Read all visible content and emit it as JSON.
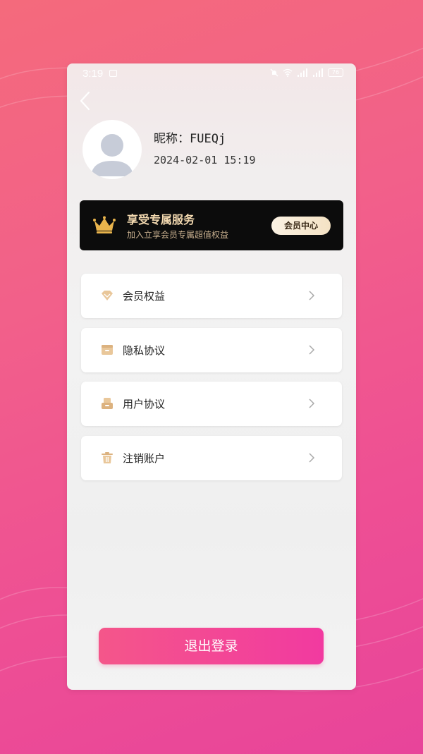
{
  "status_bar": {
    "time": "3:19",
    "battery": "76"
  },
  "profile": {
    "nickname_label": "昵称：",
    "nickname": "FUEQj",
    "datetime": "2024-02-01 15:19"
  },
  "vip_banner": {
    "title": "享受专属服务",
    "subtitle": "加入立享会员专属超值权益",
    "button_label": "会员中心"
  },
  "menu": [
    {
      "label": "会员权益",
      "icon": "diamond-icon"
    },
    {
      "label": "隐私协议",
      "icon": "document-box-icon"
    },
    {
      "label": "用户协议",
      "icon": "tray-icon"
    },
    {
      "label": "注销账户",
      "icon": "trash-icon"
    }
  ],
  "logout_label": "退出登录",
  "colors": {
    "accent": "#f2478f",
    "vip_bg": "#0c0c0c",
    "vip_gold": "#f3d9b0",
    "icon_gold": "#e9c79a"
  }
}
